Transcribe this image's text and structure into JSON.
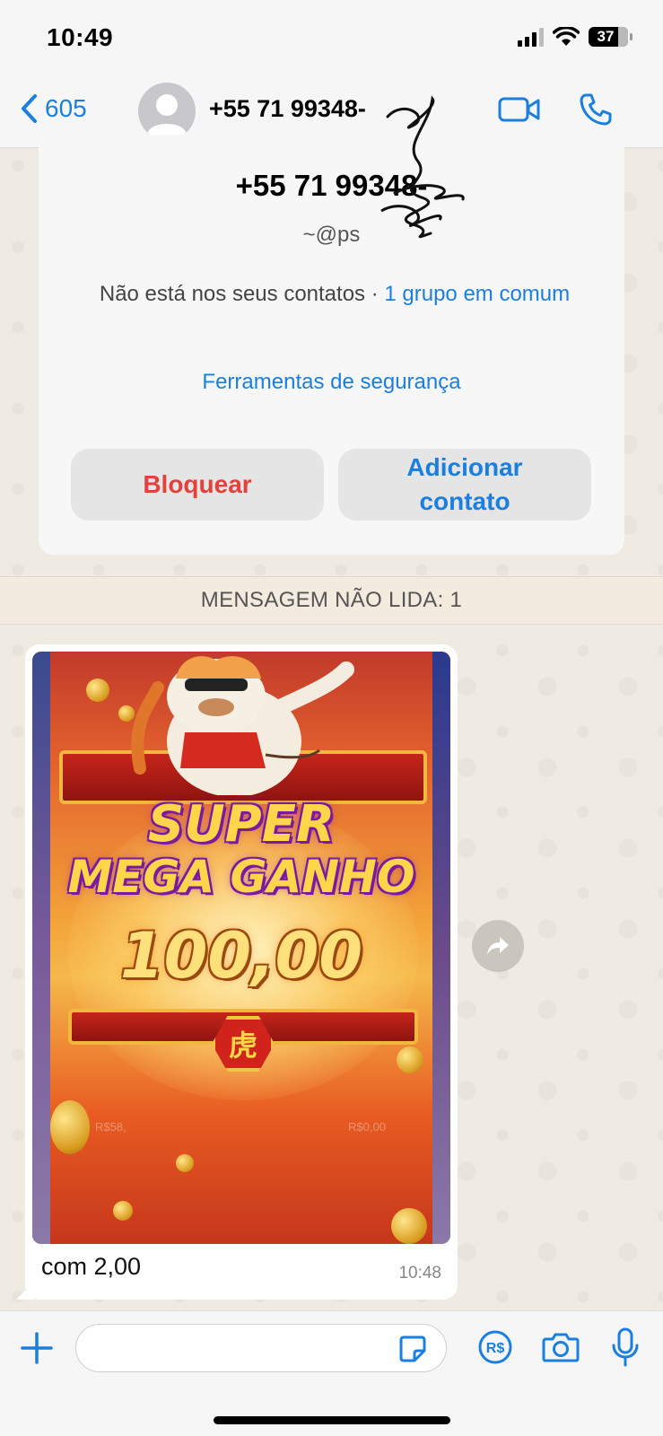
{
  "status_bar": {
    "time": "10:49",
    "battery_level": "37"
  },
  "header": {
    "back_count": "605",
    "contact_name": "+55 71 99348-",
    "icons": [
      "chevron-left-icon",
      "avatar-icon",
      "video-call-icon",
      "phone-icon"
    ]
  },
  "contact_card": {
    "phone": "+55 71 99348-",
    "handle": "~@ps",
    "not_in_contacts": "Não está nos seus contatos · ",
    "groups_link": "1 grupo em comum",
    "safety_tools": "Ferramentas de segurança",
    "block_label": "Bloquear",
    "add_contact_label": "Adicionar contato"
  },
  "unread_banner": "MENSAGEM NÃO LIDA: 1",
  "message": {
    "image": {
      "line1": "SUPER",
      "line2": "MEGA GANHO",
      "amount": "100,00",
      "emblem": "虎",
      "bet_left": "R$58,",
      "bet_right": "R$0,00"
    },
    "caption": "com 2,00",
    "time": "10:48"
  },
  "input_bar": {
    "placeholder": "",
    "icons": [
      "plus-icon",
      "sticker-icon",
      "pix-icon",
      "camera-icon",
      "microphone-icon"
    ],
    "pix_label": "R$"
  },
  "colors": {
    "accent": "#1b7fe0",
    "danger": "#e5413a",
    "chat_background": "#efeae2",
    "bubble": "#ffffff"
  }
}
